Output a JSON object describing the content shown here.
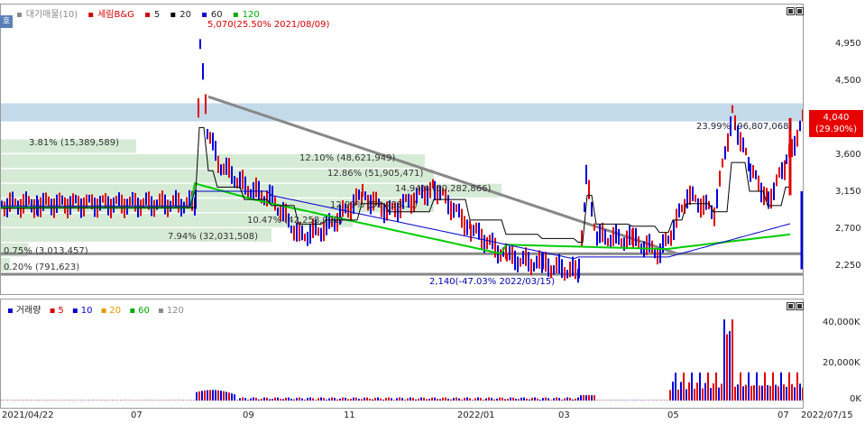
{
  "legend": {
    "items": [
      {
        "label": "대기매물(10)",
        "color": "#8a8a8a"
      },
      {
        "label": "세림B&G",
        "color": "#d40000"
      },
      {
        "label": "5",
        "color": "#000000"
      },
      {
        "label": "20",
        "color": "#000000"
      },
      {
        "label": "60",
        "color": "#0000cc"
      },
      {
        "label": "120",
        "color": "#00aa00"
      }
    ]
  },
  "volume_legend": {
    "items": [
      {
        "label": "거래량",
        "color": "#0000cc"
      },
      {
        "label": "5",
        "color": "#d40000"
      },
      {
        "label": "10",
        "color": "#0000cc"
      },
      {
        "label": "20",
        "color": "#e69900"
      },
      {
        "label": "60",
        "color": "#00aa00"
      },
      {
        "label": "120",
        "color": "#8a8a8a"
      }
    ]
  },
  "corner_label": "호",
  "price_axis": [
    "4,950",
    "4,500",
    "4,040",
    "3,600",
    "3,150",
    "2,700",
    "2,250"
  ],
  "volume_axis": [
    "40,000K",
    "20,000K",
    "0K"
  ],
  "current_price": {
    "value": "4,040",
    "change": "(29.90%)"
  },
  "date_axis": [
    "2021/04/22",
    "07",
    "09",
    "11",
    "2022/01",
    "03",
    "05",
    "07",
    "2022/07/15"
  ],
  "annotations": {
    "high": "5,070(25.50% 2021/08/09)",
    "low": "2,140(-47.03% 2022/03/15)"
  },
  "supply_bands": [
    {
      "label": "3.81% (15,389,589)"
    },
    {
      "label": "12.10% (48,621,949)"
    },
    {
      "label": "12.86% (51,905,471)"
    },
    {
      "label": "14.94% (60,282,866)"
    },
    {
      "label": "12.99% (52,438,...)"
    },
    {
      "label": "10.47% (42,258,092)"
    },
    {
      "label": "7.94% (32,031,508)"
    },
    {
      "label": "0.75% (3,013,457)"
    },
    {
      "label": "0.20% (791,623)"
    },
    {
      "label": "23.99% (96,807,068)"
    }
  ]
}
